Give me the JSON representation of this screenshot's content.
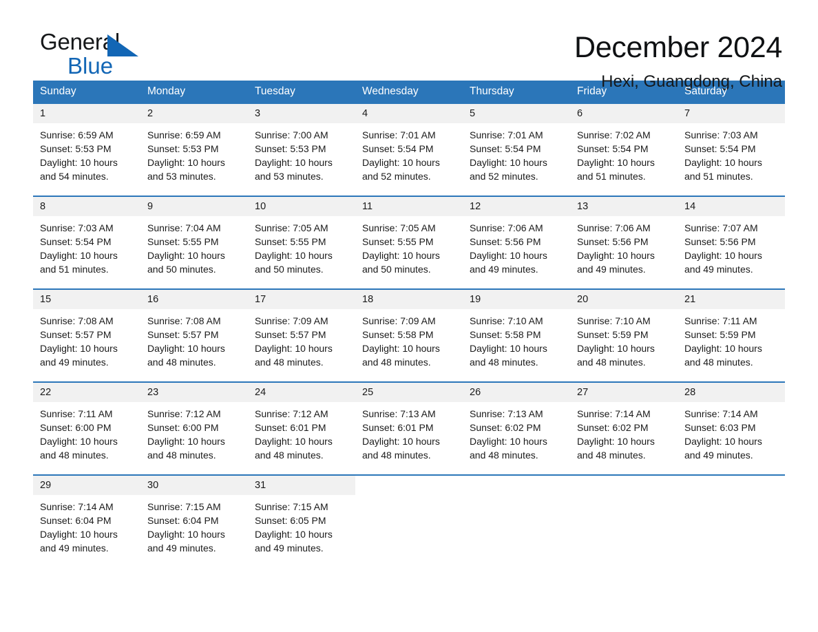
{
  "brand": {
    "name_part1": "General",
    "name_part2": "Blue",
    "flag_icon": "triangle-flag-icon",
    "accent_color": "#1266b5"
  },
  "header": {
    "title": "December 2024",
    "subtitle": "Hexi, Guangdong, China"
  },
  "calendar": {
    "header_bg": "#2b76b9",
    "daynum_bg": "#f1f1f1",
    "weekdays": [
      "Sunday",
      "Monday",
      "Tuesday",
      "Wednesday",
      "Thursday",
      "Friday",
      "Saturday"
    ],
    "weeks": [
      [
        {
          "day": "1",
          "sunrise": "Sunrise: 6:59 AM",
          "sunset": "Sunset: 5:53 PM",
          "daylight": "Daylight: 10 hours and 54 minutes."
        },
        {
          "day": "2",
          "sunrise": "Sunrise: 6:59 AM",
          "sunset": "Sunset: 5:53 PM",
          "daylight": "Daylight: 10 hours and 53 minutes."
        },
        {
          "day": "3",
          "sunrise": "Sunrise: 7:00 AM",
          "sunset": "Sunset: 5:53 PM",
          "daylight": "Daylight: 10 hours and 53 minutes."
        },
        {
          "day": "4",
          "sunrise": "Sunrise: 7:01 AM",
          "sunset": "Sunset: 5:54 PM",
          "daylight": "Daylight: 10 hours and 52 minutes."
        },
        {
          "day": "5",
          "sunrise": "Sunrise: 7:01 AM",
          "sunset": "Sunset: 5:54 PM",
          "daylight": "Daylight: 10 hours and 52 minutes."
        },
        {
          "day": "6",
          "sunrise": "Sunrise: 7:02 AM",
          "sunset": "Sunset: 5:54 PM",
          "daylight": "Daylight: 10 hours and 51 minutes."
        },
        {
          "day": "7",
          "sunrise": "Sunrise: 7:03 AM",
          "sunset": "Sunset: 5:54 PM",
          "daylight": "Daylight: 10 hours and 51 minutes."
        }
      ],
      [
        {
          "day": "8",
          "sunrise": "Sunrise: 7:03 AM",
          "sunset": "Sunset: 5:54 PM",
          "daylight": "Daylight: 10 hours and 51 minutes."
        },
        {
          "day": "9",
          "sunrise": "Sunrise: 7:04 AM",
          "sunset": "Sunset: 5:55 PM",
          "daylight": "Daylight: 10 hours and 50 minutes."
        },
        {
          "day": "10",
          "sunrise": "Sunrise: 7:05 AM",
          "sunset": "Sunset: 5:55 PM",
          "daylight": "Daylight: 10 hours and 50 minutes."
        },
        {
          "day": "11",
          "sunrise": "Sunrise: 7:05 AM",
          "sunset": "Sunset: 5:55 PM",
          "daylight": "Daylight: 10 hours and 50 minutes."
        },
        {
          "day": "12",
          "sunrise": "Sunrise: 7:06 AM",
          "sunset": "Sunset: 5:56 PM",
          "daylight": "Daylight: 10 hours and 49 minutes."
        },
        {
          "day": "13",
          "sunrise": "Sunrise: 7:06 AM",
          "sunset": "Sunset: 5:56 PM",
          "daylight": "Daylight: 10 hours and 49 minutes."
        },
        {
          "day": "14",
          "sunrise": "Sunrise: 7:07 AM",
          "sunset": "Sunset: 5:56 PM",
          "daylight": "Daylight: 10 hours and 49 minutes."
        }
      ],
      [
        {
          "day": "15",
          "sunrise": "Sunrise: 7:08 AM",
          "sunset": "Sunset: 5:57 PM",
          "daylight": "Daylight: 10 hours and 49 minutes."
        },
        {
          "day": "16",
          "sunrise": "Sunrise: 7:08 AM",
          "sunset": "Sunset: 5:57 PM",
          "daylight": "Daylight: 10 hours and 48 minutes."
        },
        {
          "day": "17",
          "sunrise": "Sunrise: 7:09 AM",
          "sunset": "Sunset: 5:57 PM",
          "daylight": "Daylight: 10 hours and 48 minutes."
        },
        {
          "day": "18",
          "sunrise": "Sunrise: 7:09 AM",
          "sunset": "Sunset: 5:58 PM",
          "daylight": "Daylight: 10 hours and 48 minutes."
        },
        {
          "day": "19",
          "sunrise": "Sunrise: 7:10 AM",
          "sunset": "Sunset: 5:58 PM",
          "daylight": "Daylight: 10 hours and 48 minutes."
        },
        {
          "day": "20",
          "sunrise": "Sunrise: 7:10 AM",
          "sunset": "Sunset: 5:59 PM",
          "daylight": "Daylight: 10 hours and 48 minutes."
        },
        {
          "day": "21",
          "sunrise": "Sunrise: 7:11 AM",
          "sunset": "Sunset: 5:59 PM",
          "daylight": "Daylight: 10 hours and 48 minutes."
        }
      ],
      [
        {
          "day": "22",
          "sunrise": "Sunrise: 7:11 AM",
          "sunset": "Sunset: 6:00 PM",
          "daylight": "Daylight: 10 hours and 48 minutes."
        },
        {
          "day": "23",
          "sunrise": "Sunrise: 7:12 AM",
          "sunset": "Sunset: 6:00 PM",
          "daylight": "Daylight: 10 hours and 48 minutes."
        },
        {
          "day": "24",
          "sunrise": "Sunrise: 7:12 AM",
          "sunset": "Sunset: 6:01 PM",
          "daylight": "Daylight: 10 hours and 48 minutes."
        },
        {
          "day": "25",
          "sunrise": "Sunrise: 7:13 AM",
          "sunset": "Sunset: 6:01 PM",
          "daylight": "Daylight: 10 hours and 48 minutes."
        },
        {
          "day": "26",
          "sunrise": "Sunrise: 7:13 AM",
          "sunset": "Sunset: 6:02 PM",
          "daylight": "Daylight: 10 hours and 48 minutes."
        },
        {
          "day": "27",
          "sunrise": "Sunrise: 7:14 AM",
          "sunset": "Sunset: 6:02 PM",
          "daylight": "Daylight: 10 hours and 48 minutes."
        },
        {
          "day": "28",
          "sunrise": "Sunrise: 7:14 AM",
          "sunset": "Sunset: 6:03 PM",
          "daylight": "Daylight: 10 hours and 49 minutes."
        }
      ],
      [
        {
          "day": "29",
          "sunrise": "Sunrise: 7:14 AM",
          "sunset": "Sunset: 6:04 PM",
          "daylight": "Daylight: 10 hours and 49 minutes."
        },
        {
          "day": "30",
          "sunrise": "Sunrise: 7:15 AM",
          "sunset": "Sunset: 6:04 PM",
          "daylight": "Daylight: 10 hours and 49 minutes."
        },
        {
          "day": "31",
          "sunrise": "Sunrise: 7:15 AM",
          "sunset": "Sunset: 6:05 PM",
          "daylight": "Daylight: 10 hours and 49 minutes."
        },
        {
          "day": "",
          "sunrise": "",
          "sunset": "",
          "daylight": ""
        },
        {
          "day": "",
          "sunrise": "",
          "sunset": "",
          "daylight": ""
        },
        {
          "day": "",
          "sunrise": "",
          "sunset": "",
          "daylight": ""
        },
        {
          "day": "",
          "sunrise": "",
          "sunset": "",
          "daylight": ""
        }
      ]
    ]
  }
}
